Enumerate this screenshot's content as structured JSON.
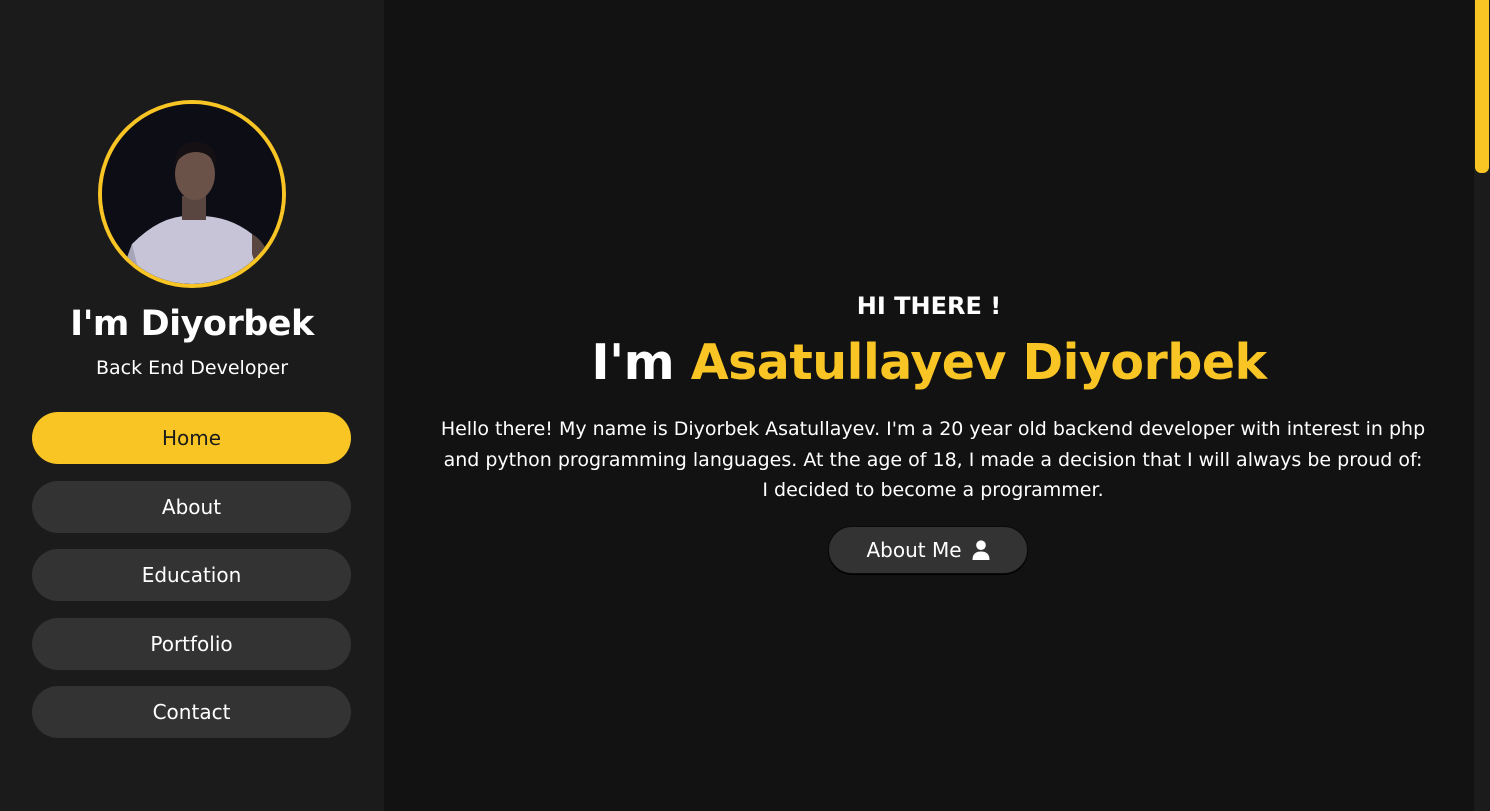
{
  "colors": {
    "accent": "#f8c524",
    "sidebar_bg": "#1b1b1b",
    "main_bg": "#121212",
    "button_bg": "#333333",
    "text": "#ffffff"
  },
  "sidebar": {
    "avatar_alt": "profile photo",
    "name": "I'm Diyorbek",
    "role": "Back End Developer",
    "nav": [
      {
        "label": "Home",
        "active": true
      },
      {
        "label": "About",
        "active": false
      },
      {
        "label": "Education",
        "active": false
      },
      {
        "label": "Portfolio",
        "active": false
      },
      {
        "label": "Contact",
        "active": false
      }
    ]
  },
  "hero": {
    "greeting": "HI THERE !",
    "headline_prefix": "I'm",
    "headline_name": "Asatullayev Diyorbek",
    "intro": "Hello there! My name is Diyorbek Asatullayev. I'm a 20 year old backend developer with interest in php and python programming languages. At the age of 18, I made a decision that I will always be proud of: I decided to become a programmer.",
    "cta_label": "About Me",
    "cta_icon": "user-icon"
  }
}
